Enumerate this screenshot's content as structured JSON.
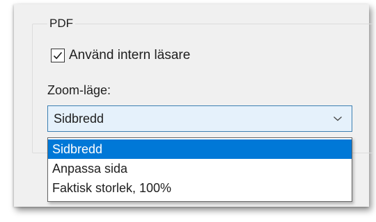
{
  "pdf_group": {
    "title": "PDF",
    "use_internal_reader": {
      "label": "Använd intern läsare",
      "checked": true
    },
    "zoom_mode": {
      "label": "Zoom-läge:",
      "selected": "Sidbredd",
      "options": [
        {
          "label": "Sidbredd",
          "highlighted": true
        },
        {
          "label": "Anpassa sida",
          "highlighted": false
        },
        {
          "label": "Faktisk storlek, 100%",
          "highlighted": false
        }
      ]
    }
  },
  "colors": {
    "selection_highlight": "#0078d7",
    "combo_border": "#3c7fb1",
    "combo_background": "#e5f1fb"
  },
  "icons": {
    "checkbox": "check-icon",
    "dropdown": "chevron-down-icon"
  }
}
